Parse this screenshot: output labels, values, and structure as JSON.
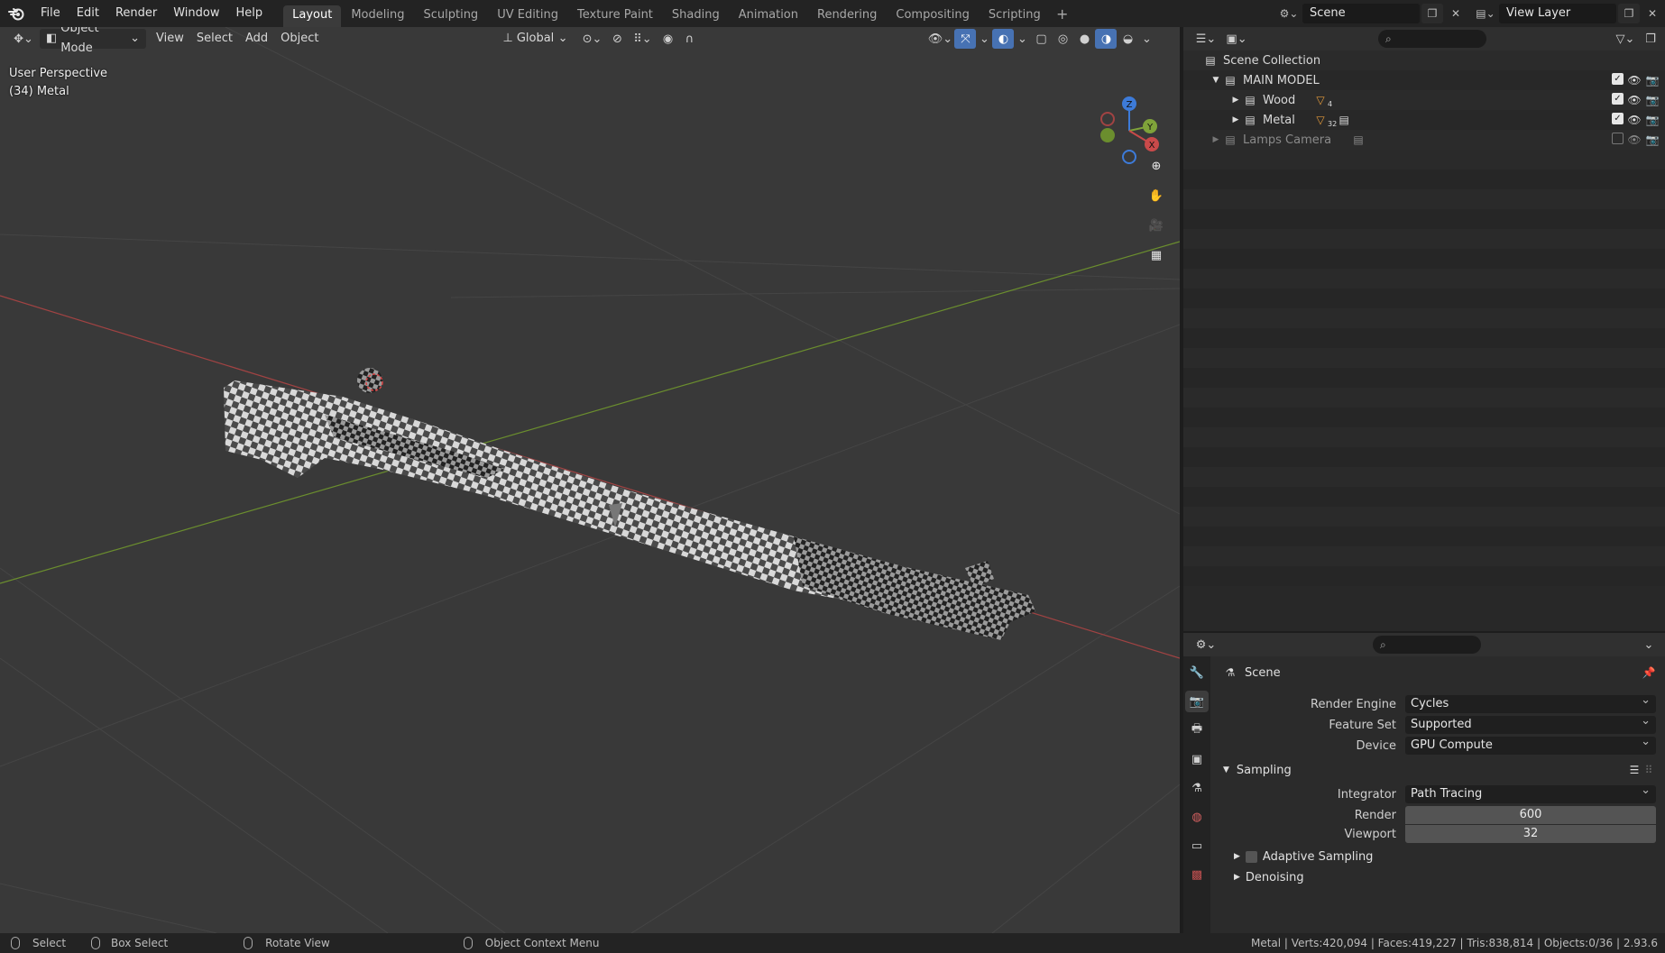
{
  "menu": [
    "File",
    "Edit",
    "Render",
    "Window",
    "Help"
  ],
  "workspaces": [
    "Layout",
    "Modeling",
    "Sculpting",
    "UV Editing",
    "Texture Paint",
    "Shading",
    "Animation",
    "Rendering",
    "Compositing",
    "Scripting"
  ],
  "active_workspace": "Layout",
  "scene_name": "Scene",
  "view_layer": "View Layer",
  "viewport": {
    "mode": "Object Mode",
    "menus": [
      "View",
      "Select",
      "Add",
      "Object"
    ],
    "transform_orientation": "Global",
    "perspective_label": "User Perspective",
    "active_object_label": "(34) Metal",
    "gizmo_axes": [
      "Z",
      "Y",
      "X"
    ]
  },
  "outliner": {
    "root": "Scene Collection",
    "rows": [
      {
        "name": "MAIN MODEL",
        "indent": 1,
        "expanded": true,
        "checked": true
      },
      {
        "name": "Wood",
        "indent": 2,
        "expanded": false,
        "checked": true,
        "badge": "4"
      },
      {
        "name": "Metal",
        "indent": 2,
        "expanded": false,
        "checked": true,
        "badge": "32"
      },
      {
        "name": "Lamps Camera",
        "indent": 1,
        "expanded": false,
        "checked": false
      }
    ]
  },
  "properties": {
    "context": "Scene",
    "render_engine_label": "Render Engine",
    "render_engine": "Cycles",
    "feature_set_label": "Feature Set",
    "feature_set": "Supported",
    "device_label": "Device",
    "device": "GPU Compute",
    "sampling_panel": "Sampling",
    "integrator_label": "Integrator",
    "integrator": "Path Tracing",
    "render_label": "Render",
    "render_samples": "600",
    "viewport_label": "Viewport",
    "viewport_samples": "32",
    "adaptive_sampling": "Adaptive Sampling",
    "denoising": "Denoising"
  },
  "statusbar": {
    "select": "Select",
    "box_select": "Box Select",
    "rotate_view": "Rotate View",
    "context_menu": "Object Context Menu",
    "stats": "Metal | Verts:420,094 | Faces:419,227 | Tris:838,814 | Objects:0/36 | 2.93.6"
  },
  "colors": {
    "accent": "#4772b3",
    "x_axis": "#c94a4a",
    "y_axis": "#7fa33a",
    "z_axis": "#3d7bd9",
    "viewport_bg": "#393939"
  }
}
